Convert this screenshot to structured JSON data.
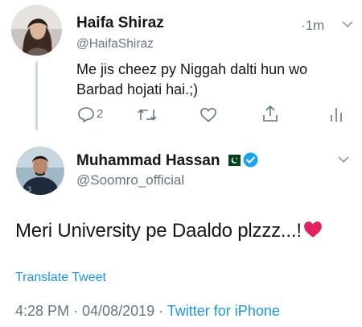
{
  "reply_tweet": {
    "author_name": "Haifa Shiraz",
    "author_handle": "@HaifaShiraz",
    "time_ago": "1m",
    "time_dot": "·",
    "text_line1": "Me jis cheez py Niggah dalti hun wo",
    "text_line2": "Barbad hojati hai.;)",
    "reply_count": "2",
    "icons": [
      "reply-icon",
      "retweet-icon",
      "like-icon",
      "share-icon",
      "analytics-icon",
      "chevron-down-icon"
    ]
  },
  "main_tweet": {
    "author_name": "Muhammad Hassan",
    "author_handle": "@Soomro_official",
    "text": "Meri University pe Daaldo plzzz...!",
    "emoji": "❤️",
    "translate_label": "Translate Tweet",
    "timestamp": "4:28 PM · 04/08/2019 · ",
    "source": "Twitter for iPhone",
    "icons": [
      "pakistan-flag-icon",
      "verified-badge-icon",
      "chevron-down-icon"
    ]
  },
  "colors": {
    "link": "#1b95e0",
    "muted": "#657786",
    "text": "#14171a",
    "heart": "#e0245e",
    "verified": "#1da1f2"
  }
}
